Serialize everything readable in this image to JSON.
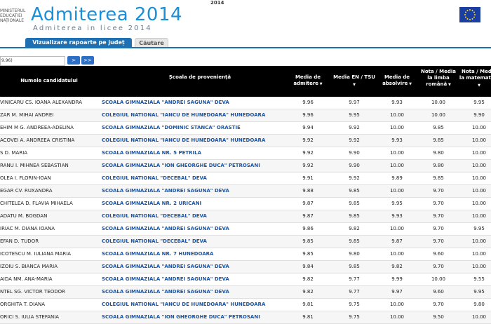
{
  "header": {
    "ministry_lines": [
      "MINISTERUL",
      "EDUCAȚIEI",
      "NAȚIONALE"
    ],
    "top_year": "2014",
    "title": "Admiterea 2014",
    "subtitle": "Admiterea in licee 2014"
  },
  "tabs": [
    {
      "label": "Vizualizare rapoarte pe județ"
    },
    {
      "label": "Căutare"
    }
  ],
  "filter": {
    "value": "9.96)",
    "next_label": ">",
    "last_label": ">>"
  },
  "columns": [
    {
      "label": "Numele candidatului"
    },
    {
      "label": "Școala de proveniență"
    },
    {
      "label": "Media de admitere"
    },
    {
      "label": "Media EN / TSU"
    },
    {
      "label": "Media de absolvire"
    },
    {
      "label": "Nota / Media la limba română"
    },
    {
      "label": "Nota / Media la matematică"
    }
  ],
  "rows": [
    {
      "name": "VINICARU CS. IOANA ALEXANDRA",
      "school": "SCOALA GIMNAZIALA \"ANDREI SAGUNA\" DEVA",
      "admitere": "9.96",
      "en": "9.97",
      "absolvire": "9.93",
      "romana": "10.00",
      "mate": "9.95"
    },
    {
      "name": "ZAR M. MIHAI ANDREI",
      "school": "COLEGIUL NATIONAL \"IANCU DE HUNEDOARA\" HUNEDOARA",
      "admitere": "9.96",
      "en": "9.95",
      "absolvire": "10.00",
      "romana": "10.00",
      "mate": "9.90"
    },
    {
      "name": "EHIM M G. ANDREEA-ADELINA",
      "school": "SCOALA GIMNAZIALA \"DOMINIC STANCA\" ORASTIE",
      "admitere": "9.94",
      "en": "9.92",
      "absolvire": "10.00",
      "romana": "9.85",
      "mate": "10.00"
    },
    {
      "name": "ACOVEI A. ANDREEA CRISTINA",
      "school": "COLEGIUL NATIONAL \"IANCU DE HUNEDOARA\" HUNEDOARA",
      "admitere": "9.92",
      "en": "9.92",
      "absolvire": "9.93",
      "romana": "9.85",
      "mate": "10.00"
    },
    {
      "name": "S D. MARIA",
      "school": "SCOALA GIMNAZIALA NR. 5 PETRILA",
      "admitere": "9.92",
      "en": "9.90",
      "absolvire": "10.00",
      "romana": "9.80",
      "mate": "10.00"
    },
    {
      "name": "RANU I. MIHNEA SEBASTIAN",
      "school": "SCOALA GIMNAZIALA \"ION GHEORGHE DUCA\" PETROSANI",
      "admitere": "9.92",
      "en": "9.90",
      "absolvire": "10.00",
      "romana": "9.80",
      "mate": "10.00"
    },
    {
      "name": "OLEA I. FLORIN-IOAN",
      "school": "COLEGIUL NATIONAL \"DECEBAL\" DEVA",
      "admitere": "9.91",
      "en": "9.92",
      "absolvire": "9.89",
      "romana": "9.85",
      "mate": "10.00"
    },
    {
      "name": "EGAR CV. RUXANDRA",
      "school": "SCOALA GIMNAZIALA \"ANDREI SAGUNA\" DEVA",
      "admitere": "9.88",
      "en": "9.85",
      "absolvire": "10.00",
      "romana": "9.70",
      "mate": "10.00"
    },
    {
      "name": "CHITELEA D. FLAVIA MIHAELA",
      "school": "SCOALA GIMNAZIALA NR. 2 URICANI",
      "admitere": "9.87",
      "en": "9.85",
      "absolvire": "9.95",
      "romana": "9.70",
      "mate": "10.00"
    },
    {
      "name": "ADATU M. BOGDAN",
      "school": "COLEGIUL NATIONAL \"DECEBAL\" DEVA",
      "admitere": "9.87",
      "en": "9.85",
      "absolvire": "9.93",
      "romana": "9.70",
      "mate": "10.00"
    },
    {
      "name": "IRIAC M. DIANA IOANA",
      "school": "SCOALA GIMNAZIALA \"ANDREI SAGUNA\" DEVA",
      "admitere": "9.86",
      "en": "9.82",
      "absolvire": "10.00",
      "romana": "9.70",
      "mate": "9.95"
    },
    {
      "name": "EFAN D. TUDOR",
      "school": "COLEGIUL NATIONAL \"DECEBAL\" DEVA",
      "admitere": "9.85",
      "en": "9.85",
      "absolvire": "9.87",
      "romana": "9.70",
      "mate": "10.00"
    },
    {
      "name": "ICOTESCU M. IULIANA MARIA",
      "school": "SCOALA GIMNAZIALA NR. 7 HUNEDOARA",
      "admitere": "9.85",
      "en": "9.80",
      "absolvire": "10.00",
      "romana": "9.60",
      "mate": "10.00"
    },
    {
      "name": "IZOIU S. BIANCA MARIA",
      "school": "SCOALA GIMNAZIALA \"ANDREI SAGUNA\" DEVA",
      "admitere": "9.84",
      "en": "9.85",
      "absolvire": "9.82",
      "romana": "9.70",
      "mate": "10.00"
    },
    {
      "name": "AIDA NM. ANA-MARIA",
      "school": "SCOALA GIMNAZIALA \"ANDREI SAGUNA\" DEVA",
      "admitere": "9.82",
      "en": "9.77",
      "absolvire": "9.99",
      "romana": "10.00",
      "mate": "9.55"
    },
    {
      "name": "NTEL SG. VICTOR TEODOR",
      "school": "SCOALA GIMNAZIALA \"ANDREI SAGUNA\" DEVA",
      "admitere": "9.82",
      "en": "9.77",
      "absolvire": "9.97",
      "romana": "9.60",
      "mate": "9.95"
    },
    {
      "name": "ORGHITA T. DIANA",
      "school": "COLEGIUL NATIONAL \"IANCU DE HUNEDOARA\" HUNEDOARA",
      "admitere": "9.81",
      "en": "9.75",
      "absolvire": "10.00",
      "romana": "9.70",
      "mate": "9.80"
    },
    {
      "name": "ORICI S. IULIA STEFANIA",
      "school": "SCOALA GIMNAZIALA \"ION GHEORGHE DUCA\" PETROSANI",
      "admitere": "9.81",
      "en": "9.75",
      "absolvire": "10.00",
      "romana": "9.50",
      "mate": "10.00"
    }
  ]
}
